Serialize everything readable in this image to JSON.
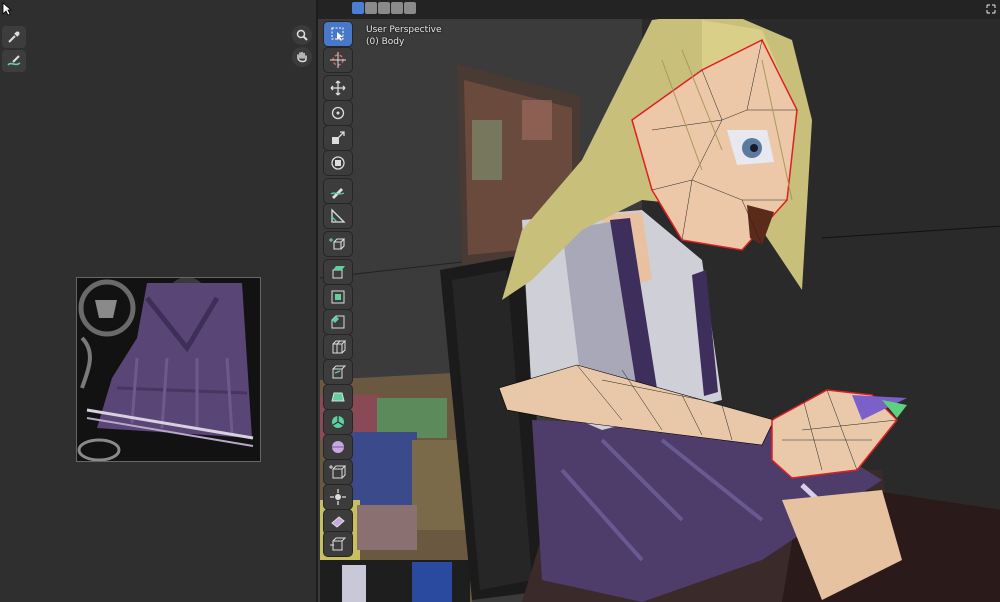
{
  "uv_editor": {
    "tools": [
      {
        "name": "sample-tool",
        "icon": "eyedropper-icon"
      },
      {
        "name": "annotate-tool",
        "icon": "annotate-pen-icon"
      }
    ],
    "nav": [
      {
        "name": "zoom",
        "icon": "zoom-icon"
      },
      {
        "name": "pan",
        "icon": "hand-icon"
      }
    ]
  },
  "viewport": {
    "view_name": "User Perspective",
    "object_name": "(0) Body",
    "select_modes": [
      "vertex",
      "edge",
      "face",
      "extend",
      "subtract"
    ],
    "tools": [
      {
        "name": "select-box",
        "icon": "select-box-icon",
        "active": true
      },
      {
        "name": "cursor",
        "icon": "cursor-3d-icon"
      },
      {
        "name": "move",
        "icon": "move-icon"
      },
      {
        "name": "rotate",
        "icon": "rotate-icon"
      },
      {
        "name": "scale",
        "icon": "scale-icon"
      },
      {
        "name": "transform",
        "icon": "transform-icon"
      },
      {
        "name": "annotate",
        "icon": "annotate-icon"
      },
      {
        "name": "measure",
        "icon": "measure-icon"
      },
      {
        "name": "add-cube",
        "icon": "add-cube-icon"
      },
      {
        "name": "extrude",
        "icon": "extrude-icon"
      },
      {
        "name": "inset",
        "icon": "inset-icon"
      },
      {
        "name": "bevel",
        "icon": "bevel-icon"
      },
      {
        "name": "loop-cut",
        "icon": "loop-cut-icon"
      },
      {
        "name": "knife",
        "icon": "knife-icon"
      },
      {
        "name": "poly-build",
        "icon": "poly-build-icon"
      },
      {
        "name": "spin",
        "icon": "spin-icon"
      },
      {
        "name": "smooth",
        "icon": "smooth-icon"
      },
      {
        "name": "edge-slide",
        "icon": "edge-slide-icon"
      },
      {
        "name": "shrink-fatten",
        "icon": "shrink-fatten-icon"
      },
      {
        "name": "shear",
        "icon": "shear-icon"
      },
      {
        "name": "rip",
        "icon": "rip-icon"
      }
    ]
  },
  "colors": {
    "active_tool": "#4a78c8",
    "selected_edge": "#e02020",
    "panel_bg": "#2f2f2f"
  }
}
